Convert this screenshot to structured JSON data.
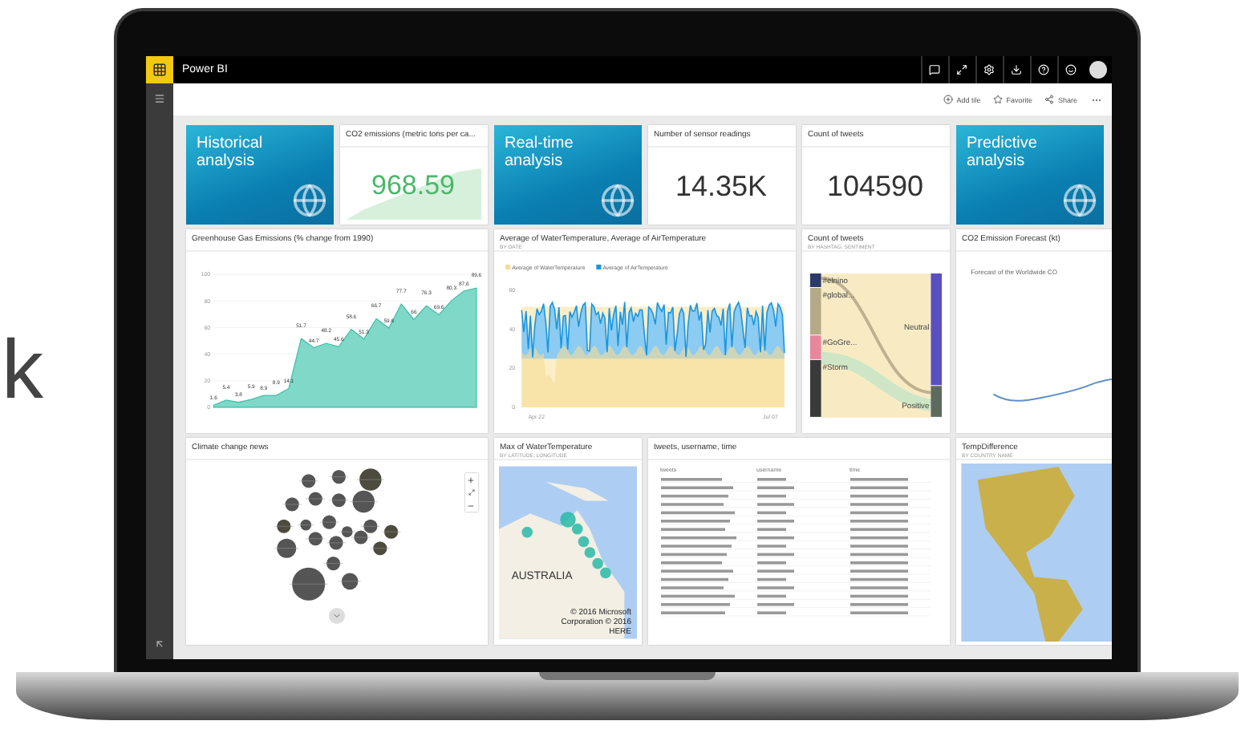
{
  "side_text": "k",
  "app": {
    "title": "Power BI"
  },
  "actions": [
    {
      "kind": "add",
      "label": "Add tile"
    },
    {
      "kind": "star",
      "label": "Favorite"
    },
    {
      "kind": "share",
      "label": "Share"
    }
  ],
  "rows": [
    {
      "tiles": [
        {
          "kind": "hero",
          "title": "Historical analysis"
        },
        {
          "kind": "kpi",
          "title": "CO2 emissions (metric tons per ca...",
          "value": "968.59",
          "trend": true
        },
        {
          "kind": "hero",
          "title": "Real-time analysis"
        },
        {
          "kind": "kpi",
          "title": "Number of sensor readings",
          "value": "14.35K",
          "trend": false
        },
        {
          "kind": "kpi",
          "title": "Count of tweets",
          "value": "104590",
          "trend": false
        },
        {
          "kind": "hero",
          "title": "Predictive analysis"
        }
      ]
    },
    {
      "tiles": [
        {
          "kind": "area",
          "title": "Greenhouse Gas Emissions (% change from 1990)",
          "chart_data": {
            "type": "area",
            "values": [
              1.6,
              5.4,
              3.8,
              5.9,
              8.9,
              8.9,
              14.1,
              51.7,
              44.7,
              48.2,
              45.6,
              58.6,
              51.3,
              66.7,
              59.6,
              77.7,
              66.0,
              76.3,
              69.6,
              80.3,
              87.6,
              89.6
            ],
            "ylim": [
              0,
              100
            ],
            "yticks": [
              0,
              20,
              40,
              60,
              80,
              100
            ],
            "data_labels": true,
            "grid": true
          }
        },
        {
          "kind": "line",
          "title": "Average of WaterTemperature, Average of AirTemperature",
          "subtitle": "BY DATE",
          "legend": [
            {
              "label": "Average of WaterTemperature",
              "color": "#f6dc94"
            },
            {
              "label": "Average of AirTemperature",
              "color": "#1a96e0"
            }
          ],
          "y_labels": [
            "60",
            "40",
            "20",
            "0"
          ],
          "x_labels": [
            "Apr 22",
            "Jul 07"
          ]
        },
        {
          "kind": "sankey",
          "title": "Count of tweets",
          "subtitle": "BY HASHTAG, SENTIMENT",
          "sources": [
            {
              "label": "#elnino",
              "color": "#2b3a67"
            },
            {
              "label": "#global...",
              "color": "#b5a987"
            },
            {
              "label": "#GoGre...",
              "color": "#e8869c"
            },
            {
              "label": "#Storm",
              "color": "#3a3a3a"
            }
          ],
          "targets": [
            {
              "label": "Neutral",
              "color": "#5a4fc0"
            },
            {
              "label": "Positive",
              "color": "#5f6a5f"
            }
          ]
        },
        {
          "kind": "forecast",
          "title": "CO2 Emission Forecast (kt)",
          "chart_title": "Forecast of the Worldwide CO"
        }
      ]
    },
    {
      "tiles": [
        {
          "kind": "news",
          "title": "Climate change news"
        },
        {
          "kind": "map",
          "title": "Max of WaterTemperature",
          "subtitle": "BY LATITUDE, LONGITUDE",
          "label": "AUSTRALIA",
          "credit": "© 2016 Microsoft Corporation © 2016 HERE"
        },
        {
          "kind": "table",
          "title": "tweets, username, time",
          "columns": [
            "tweets",
            "username",
            "time"
          ]
        },
        {
          "kind": "choropleth",
          "title": "TempDifference",
          "subtitle": "BY COUNTRY NAME"
        }
      ]
    }
  ]
}
